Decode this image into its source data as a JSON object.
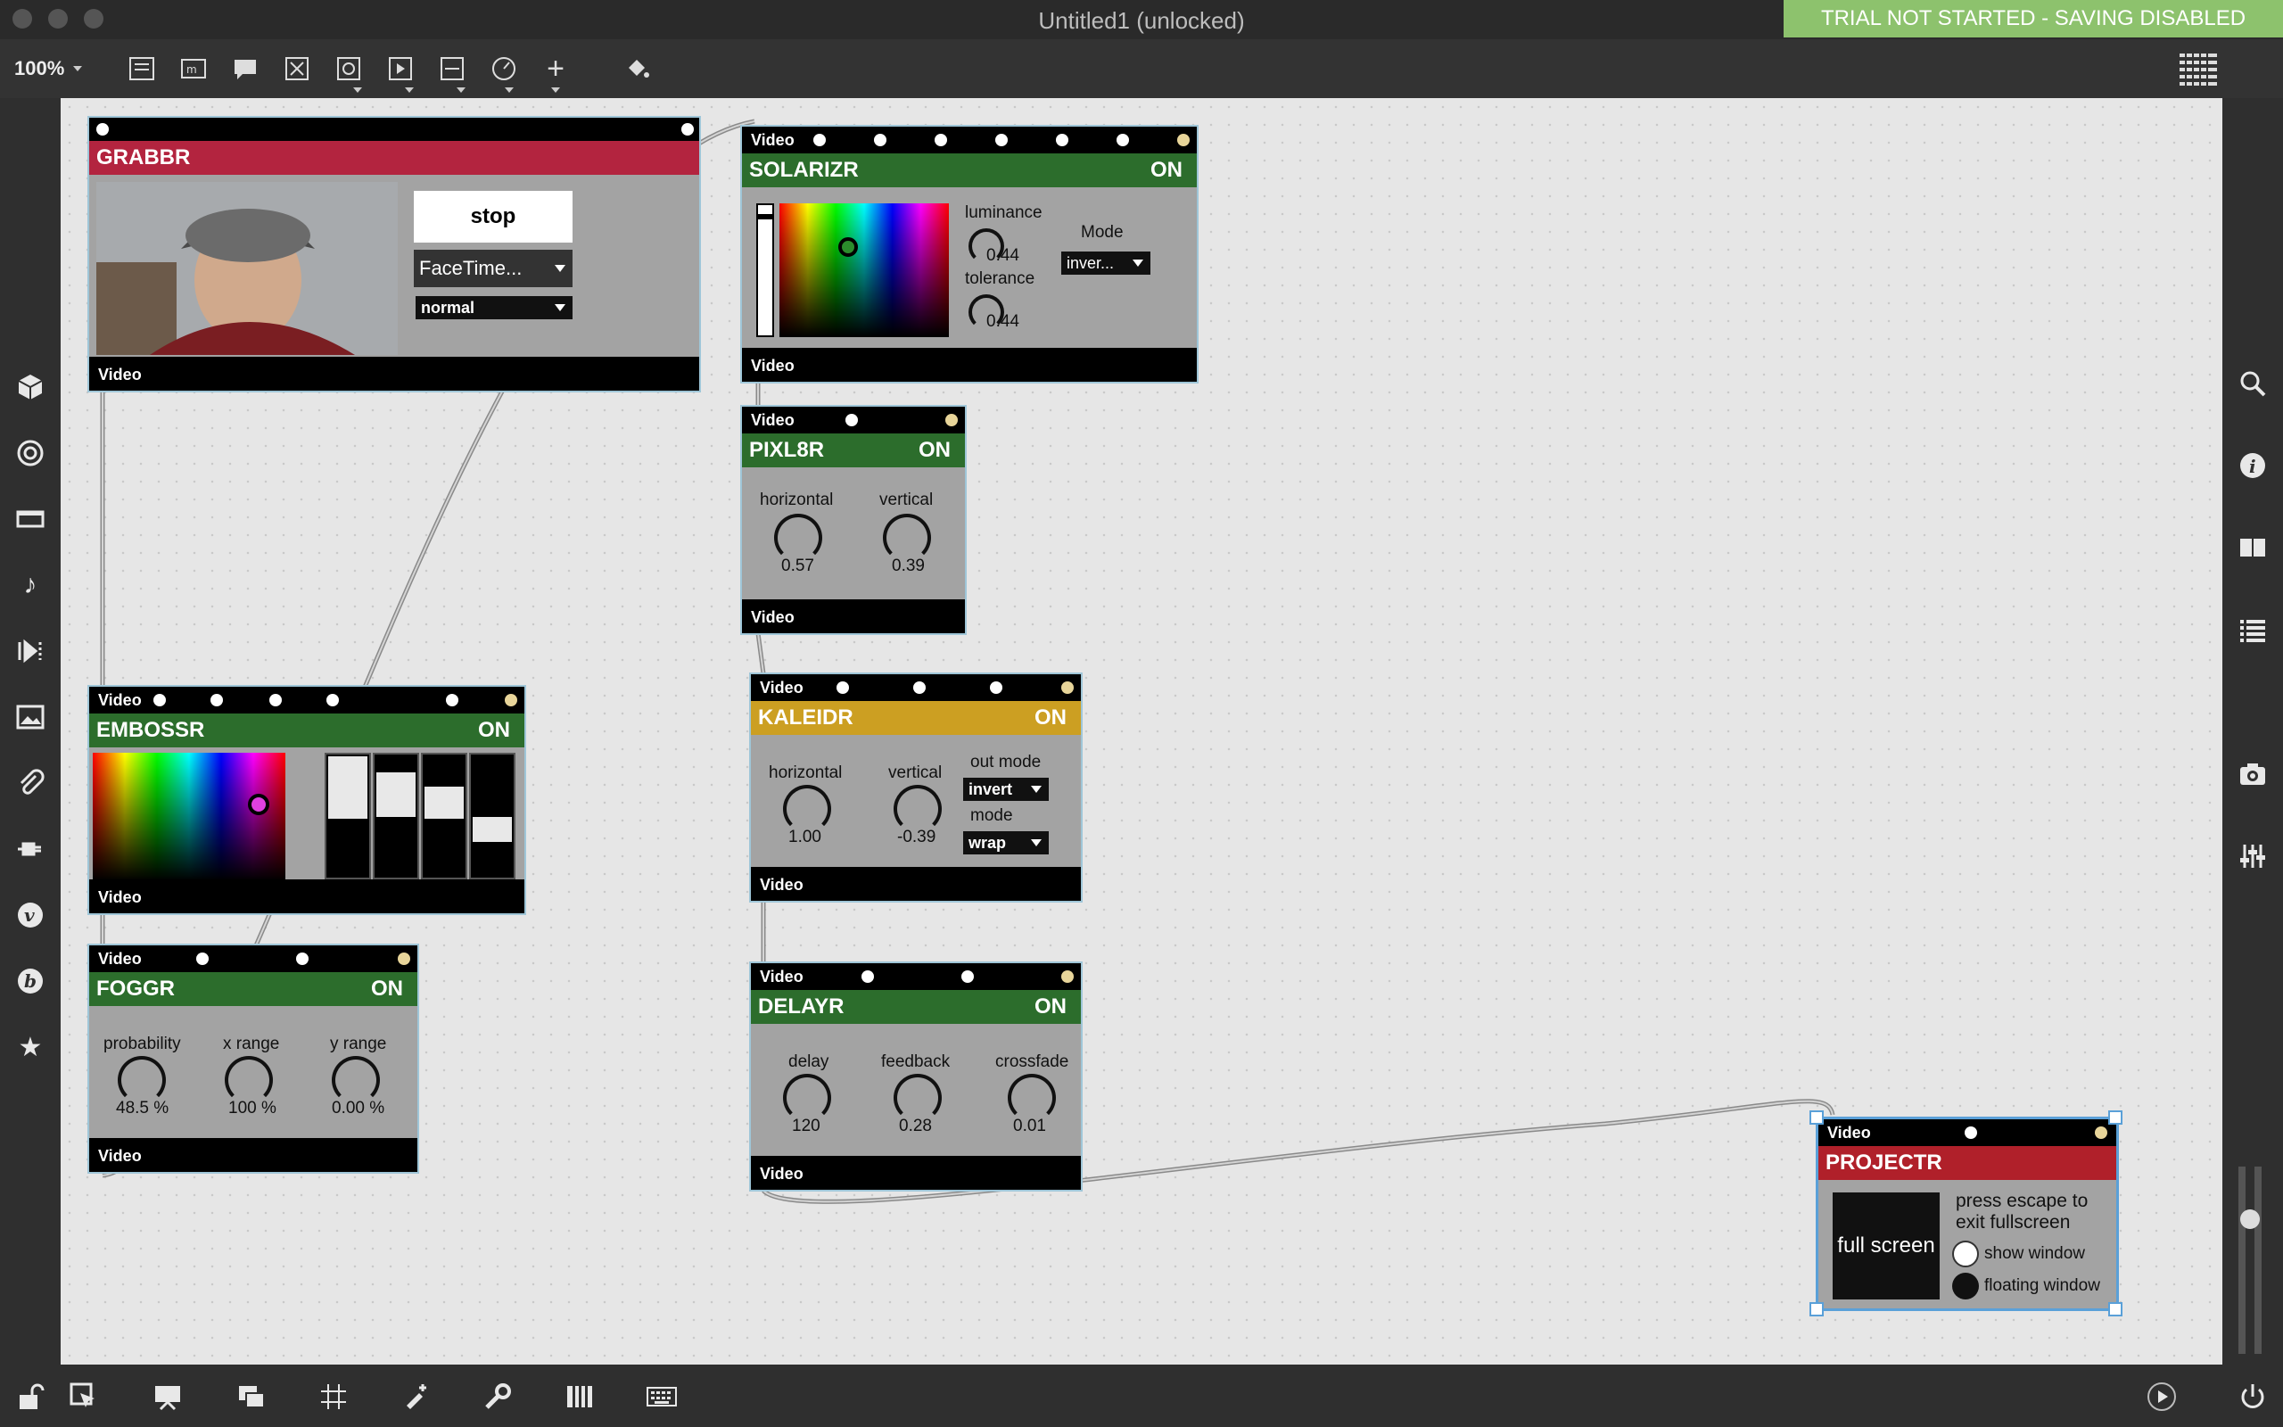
{
  "window": {
    "title": "Untitled1 (unlocked)",
    "trial_banner": "TRIAL NOT STARTED - SAVING DISABLED",
    "zoom": "100%"
  },
  "toolbar": {
    "icons": [
      "new-patcher-icon",
      "message-icon",
      "comment-icon",
      "toggle-icon",
      "button-icon",
      "play-icon",
      "slider-icon",
      "dial-icon",
      "add-object-icon",
      "paint-bucket-icon"
    ],
    "grid_icon": "grid-icon"
  },
  "leftbar": {
    "icons": [
      "package-icon",
      "target-icon",
      "video-player-icon",
      "music-note-icon",
      "step-forward-icon",
      "image-icon",
      "clip-icon",
      "plug-icon",
      "vimeo-icon",
      "bold-b-icon",
      "star-icon"
    ]
  },
  "rightbar": {
    "icons": [
      "search-icon",
      "info-icon",
      "book-icon",
      "list-icon",
      "camera-icon",
      "mixer-icon"
    ]
  },
  "bottombar": {
    "icons": [
      "lock-icon",
      "cursor-icon",
      "presentation-icon",
      "layers-icon",
      "grid-snap-icon",
      "debug-icon",
      "wrench-icon",
      "piano-icon",
      "keyboard-icon",
      "transport-icon",
      "power-icon"
    ]
  },
  "grabbr": {
    "title": "GRABBR",
    "stop": "stop",
    "device": "FaceTime...",
    "mode": "normal",
    "out": "Video"
  },
  "solarizr": {
    "in": "Video",
    "title": "SOLARIZR",
    "on": "ON",
    "luminance_label": "luminance",
    "luminance": "0.44",
    "tolerance_label": "tolerance",
    "tolerance": "0.44",
    "mode_label": "Mode",
    "mode": "inver...",
    "out": "Video"
  },
  "pixl8r": {
    "in": "Video",
    "title": "PIXL8R",
    "on": "ON",
    "horizontal_label": "horizontal",
    "horizontal": "0.57",
    "vertical_label": "vertical",
    "vertical": "0.39",
    "out": "Video"
  },
  "kaleidr": {
    "in": "Video",
    "title": "KALEIDR",
    "on": "ON",
    "horizontal_label": "horizontal",
    "horizontal": "1.00",
    "vertical_label": "vertical",
    "vertical": "-0.39",
    "out_mode_label": "out mode",
    "out_mode": "invert",
    "mode_label": "mode",
    "mode": "wrap",
    "out": "Video"
  },
  "embossr": {
    "in": "Video",
    "title": "EMBOSSR",
    "on": "ON",
    "sliders": [
      0.55,
      0.45,
      0.25,
      0.15
    ],
    "out": "Video"
  },
  "foggr": {
    "in": "Video",
    "title": "FOGGR",
    "on": "ON",
    "probability_label": "probability",
    "probability": "48.5 %",
    "xrange_label": "x range",
    "xrange": "100 %",
    "yrange_label": "y range",
    "yrange": "0.00 %",
    "out": "Video"
  },
  "delayr": {
    "in": "Video",
    "title": "DELAYR",
    "on": "ON",
    "delay_label": "delay",
    "delay": "120",
    "feedback_label": "feedback",
    "feedback": "0.28",
    "crossfade_label": "crossfade",
    "crossfade": "0.01",
    "out": "Video"
  },
  "projectr": {
    "in": "Video",
    "title": "PROJECTR",
    "fullscreen": "full screen",
    "escape_note": "press escape to exit fullscreen",
    "show_window": "show window",
    "floating_window": "floating window"
  },
  "colors": {
    "trial": "#8dc26d",
    "green_header": "#2c6d2c",
    "red_header": "#b3243f",
    "gold_header": "#cc9f22"
  }
}
